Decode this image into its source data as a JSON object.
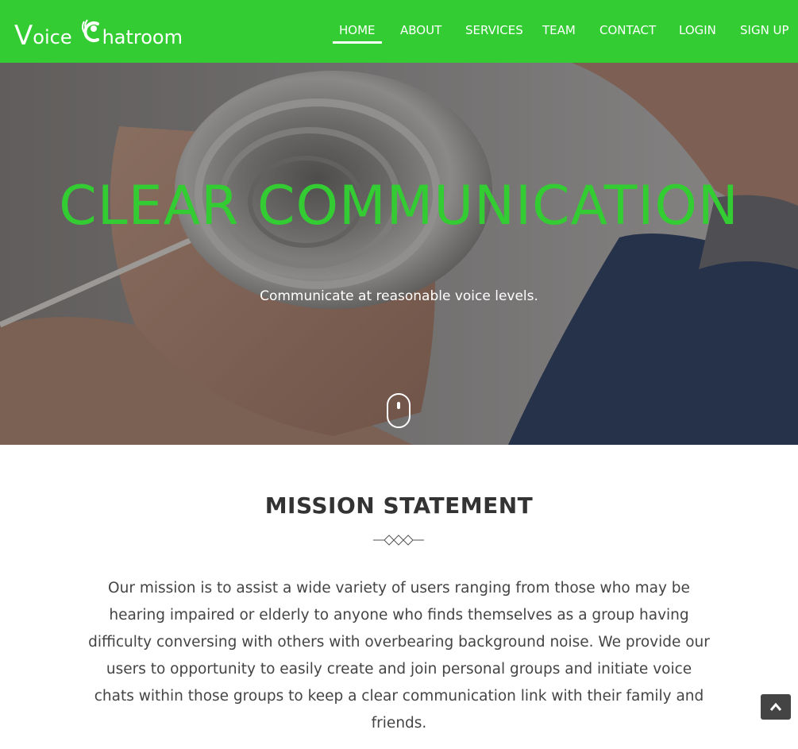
{
  "brand": {
    "v_letter": "V",
    "oice": "oice",
    "c_icon": "chat-bubble-c-icon",
    "hatroom": "hatroom"
  },
  "nav": {
    "items": [
      {
        "label": "HOME",
        "active": true
      },
      {
        "label": "ABOUT"
      },
      {
        "label": "SERVICES"
      },
      {
        "label": "TEAM"
      },
      {
        "label": "CONTACT"
      },
      {
        "label": "LOGIN"
      },
      {
        "label": "SIGN UP"
      }
    ]
  },
  "hero": {
    "title": "CLEAR COMMUNICATION",
    "subtitle": "Communicate at reasonable voice levels.",
    "scroll_icon": "mouse-scroll-icon"
  },
  "mission": {
    "title": "MISSION STATEMENT",
    "divider_icon": "diamond-divider-icon",
    "text": "Our mission is to assist a wide variety of users ranging from those who may be hearing impaired or elderly to anyone who finds themselves as a group having difficulty conversing with others with overbearing background noise. We provide our users to opportunity to easily create and join personal groups and initiate voice chats within those groups to keep a clear communication link with their family and friends."
  },
  "back_to_top_icon": "chevron-up-icon",
  "colors": {
    "accent": "#33cc33",
    "nav_text": "#ffffff",
    "body_text": "#444444",
    "top_button": "#444444"
  }
}
